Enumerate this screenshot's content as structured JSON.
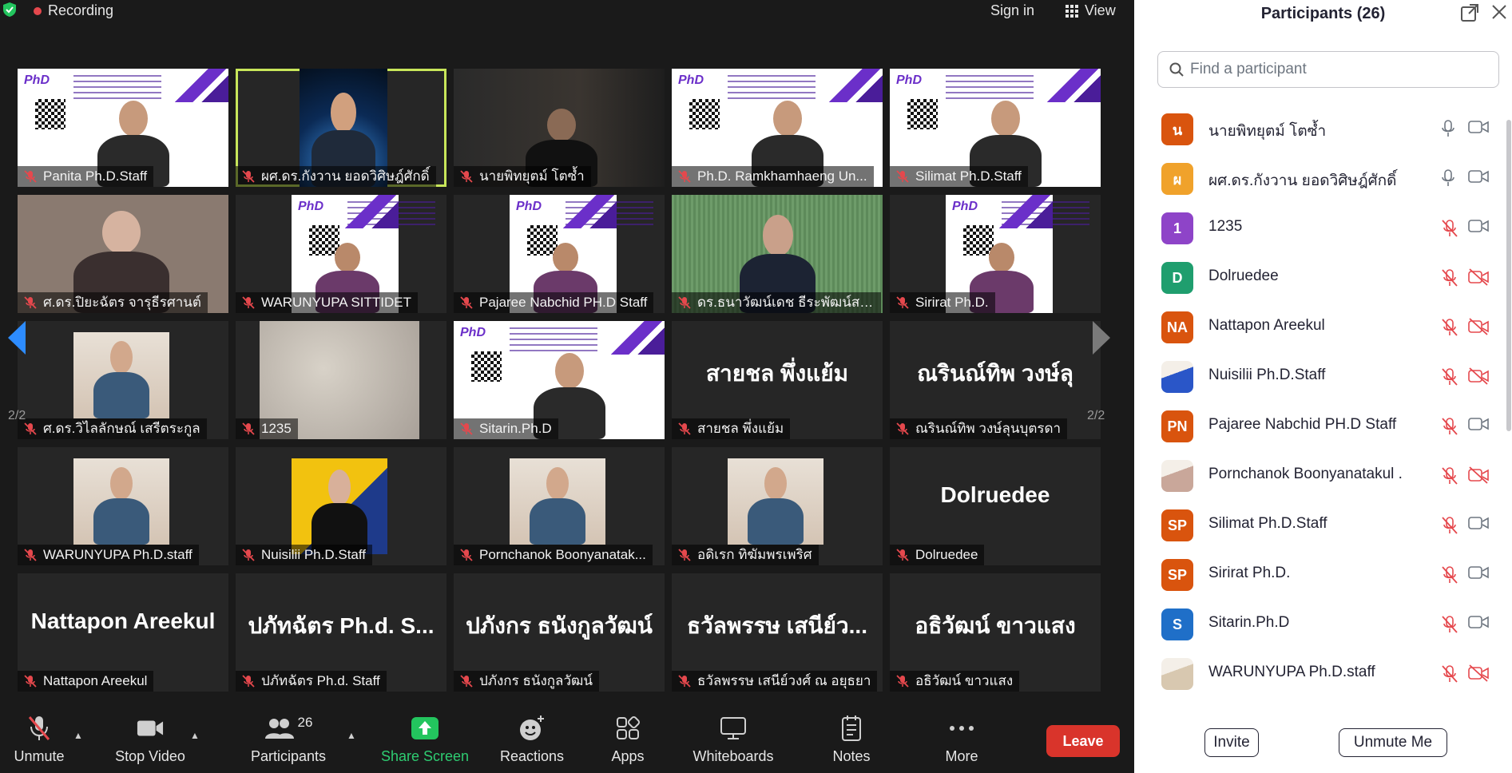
{
  "topbar": {
    "recording_label": "Recording",
    "signin_label": "Sign in",
    "view_label": "View"
  },
  "tiles": [
    {
      "name": "Panita Ph.D.Staff",
      "kind": "poster"
    },
    {
      "name": "ผศ.ดร.กังวาน  ยอดวิศิษฎ์ศักดิ์",
      "kind": "space",
      "speaking": true
    },
    {
      "name": "นายพิทยุตม์  โตซ้ำ",
      "kind": "dark"
    },
    {
      "name": "Ph.D. Ramkhamhaeng Un...",
      "kind": "poster"
    },
    {
      "name": "Silimat Ph.D.Staff",
      "kind": "poster"
    },
    {
      "name": "ศ.ดร.ปิยะฉัตร  จารุธีรศานต์",
      "kind": "face"
    },
    {
      "name": "WARUNYUPA SITTIDET",
      "kind": "poster-narrow"
    },
    {
      "name": "Pajaree Nabchid PH.D Staff",
      "kind": "poster-narrow"
    },
    {
      "name": "ดร.ธนาวัฒน์เดช  ธีระพัฒน์สกุล",
      "kind": "green"
    },
    {
      "name": "Sirirat Ph.D.",
      "kind": "poster-narrow"
    },
    {
      "name": "ศ.ดร.วิไลลักษณ์  เสรีตระกูล",
      "kind": "photo-small"
    },
    {
      "name": "1235",
      "kind": "texture"
    },
    {
      "name": "Sitarin.Ph.D",
      "kind": "poster"
    },
    {
      "name": "สายชล  พึ่งแย้ม",
      "kind": "text",
      "big": "สายชล  พึ่งแย้ม"
    },
    {
      "name": "ณรินณ์ทิพ วงษ์ลุนบุตรดา",
      "kind": "text",
      "big": "ณรินณ์ทิพ วงษ์ลุ"
    },
    {
      "name": "WARUNYUPA Ph.D.staff",
      "kind": "photo-small"
    },
    {
      "name": "Nuisilii Ph.D.Staff",
      "kind": "yellow"
    },
    {
      "name": "Pornchanok Boonyanatak...",
      "kind": "photo-small"
    },
    {
      "name": "อดิเรก ทิฆัมพรเพริศ",
      "kind": "photo-small"
    },
    {
      "name": "Dolruedee",
      "kind": "text",
      "big": "Dolruedee"
    },
    {
      "name": "Nattapon Areekul",
      "kind": "text",
      "big": "Nattapon Areekul"
    },
    {
      "name": "ปภัทฉัตร Ph.d. Staff",
      "kind": "text",
      "big": "ปภัทฉัตร Ph.d. S..."
    },
    {
      "name": "ปภังกร ธนังกูลวัฒน์",
      "kind": "text",
      "big": "ปภังกร ธนังกูลวัฒน์"
    },
    {
      "name": "ธวัลพรรษ เสนีย์วงศ์ ณ อยุธยา",
      "kind": "text",
      "big": "ธวัลพรรษ เสนีย์ว..."
    },
    {
      "name": "อธิวัฒน์ ขาวแสง",
      "kind": "text",
      "big": "อธิวัฒน์ ขาวแสง"
    }
  ],
  "pager": {
    "left": "2/2",
    "right": "2/2"
  },
  "toolbar": {
    "unmute": "Unmute",
    "stop_video": "Stop Video",
    "participants": "Participants",
    "participants_count": "26",
    "share_screen": "Share Screen",
    "reactions": "Reactions",
    "apps": "Apps",
    "whiteboards": "Whiteboards",
    "notes": "Notes",
    "more": "More",
    "leave": "Leave"
  },
  "panel": {
    "title": "Participants (26)",
    "search_placeholder": "Find a participant",
    "invite": "Invite",
    "unmute_me": "Unmute Me",
    "participants": [
      {
        "initials": "น",
        "color": "#d9540e",
        "name": "นายพิทยุตม์  โตซ้ำ",
        "mic": "on",
        "cam": "on"
      },
      {
        "initials": "ผ",
        "color": "#f0a22b",
        "name": "ผศ.ดร.กังวาน  ยอดวิศิษฎ์ศักดิ์",
        "mic": "on",
        "cam": "on"
      },
      {
        "initials": "1",
        "color": "#8e44c8",
        "name": "1235",
        "mic": "off",
        "cam": "on"
      },
      {
        "initials": "D",
        "color": "#1f9e6e",
        "name": "Dolruedee",
        "mic": "off",
        "cam": "off"
      },
      {
        "initials": "NA",
        "color": "#d9540e",
        "name": "Nattapon Areekul",
        "mic": "off",
        "cam": "off"
      },
      {
        "initials": "",
        "color": "#2a56c8",
        "name": "Nuisilii Ph.D.Staff",
        "mic": "off",
        "cam": "off",
        "photo": true
      },
      {
        "initials": "PN",
        "color": "#d9540e",
        "name": "Pajaree Nabchid PH.D Staff",
        "mic": "off",
        "cam": "on"
      },
      {
        "initials": "",
        "color": "#c9a79a",
        "name": "Pornchanok Boonyanatakul .",
        "mic": "off",
        "cam": "off",
        "photo": true
      },
      {
        "initials": "SP",
        "color": "#d9540e",
        "name": "Silimat Ph.D.Staff",
        "mic": "off",
        "cam": "on"
      },
      {
        "initials": "SP",
        "color": "#d9540e",
        "name": "Sirirat Ph.D.",
        "mic": "off",
        "cam": "on"
      },
      {
        "initials": "S",
        "color": "#1f6fc8",
        "name": "Sitarin.Ph.D",
        "mic": "off",
        "cam": "on"
      },
      {
        "initials": "",
        "color": "#d8c8b0",
        "name": "WARUNYUPA Ph.D.staff",
        "mic": "off",
        "cam": "off",
        "photo": true
      }
    ]
  }
}
